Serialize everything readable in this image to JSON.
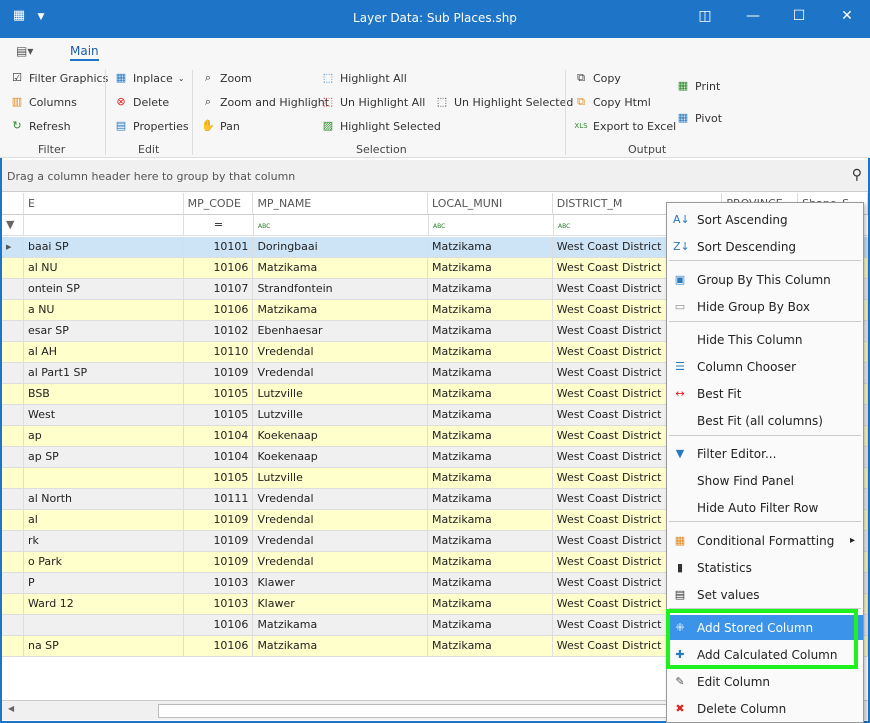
{
  "window": {
    "title": "Layer Data: Sub Places.shp",
    "restore": "◫",
    "maximize": "☐",
    "close": "✕"
  },
  "ribbon": {
    "tab": "Main",
    "filter": {
      "label": "Filter",
      "items": [
        "Filter Graphics",
        "Columns",
        "Refresh"
      ]
    },
    "edit": {
      "label": "Edit",
      "items": [
        "Inplace",
        "Delete",
        "Properties"
      ]
    },
    "selection": {
      "label": "Selection",
      "items": [
        "Zoom",
        "Zoom and Highlight",
        "Pan",
        "Highlight All",
        "Un Highlight All",
        "Highlight Selected",
        "Un Highlight Selected"
      ]
    },
    "output": {
      "label": "Output",
      "items": [
        "Copy",
        "Copy Html",
        "Export to Excel",
        "Print",
        "Pivot"
      ]
    }
  },
  "group_panel": "Drag a column header here to group by that column",
  "columns": [
    "E",
    "MP_CODE",
    "MP_NAME",
    "LOCAL_MUNI",
    "DISTRICT_M",
    "PROVINCE",
    "Shape_S"
  ],
  "filter_row": {
    "mp_code": "=",
    "text": "ABC"
  },
  "rows": [
    [
      "baai SP",
      "10101",
      "Doringbaai",
      "Matzikama",
      "West Coast District Mu"
    ],
    [
      "al NU",
      "10106",
      "Matzikama",
      "Matzikama",
      "West Coast District Mu"
    ],
    [
      "ontein SP",
      "10107",
      "Strandfontein",
      "Matzikama",
      "West Coast District Mu"
    ],
    [
      "a  NU",
      "10106",
      "Matzikama",
      "Matzikama",
      "West Coast District Mu"
    ],
    [
      "esar SP",
      "10102",
      "Ebenhaesar",
      "Matzikama",
      "West Coast District Mu"
    ],
    [
      "al AH",
      "10110",
      "Vredendal",
      "Matzikama",
      "West Coast District Mu"
    ],
    [
      "al Part1 SP",
      "10109",
      "Vredendal",
      "Matzikama",
      "West Coast District Mu"
    ],
    [
      "BSB",
      "10105",
      "Lutzville",
      "Matzikama",
      "West Coast District Mu"
    ],
    [
      "West",
      "10105",
      "Lutzville",
      "Matzikama",
      "West Coast District Mu"
    ],
    [
      "ap",
      "10104",
      "Koekenaap",
      "Matzikama",
      "West Coast District Mu"
    ],
    [
      "ap SP",
      "10104",
      "Koekenaap",
      "Matzikama",
      "West Coast District Mu"
    ],
    [
      "",
      "10105",
      "Lutzville",
      "Matzikama",
      "West Coast District Mu"
    ],
    [
      "al North",
      "10111",
      "Vredendal",
      "Matzikama",
      "West Coast District Mu"
    ],
    [
      "al",
      "10109",
      "Vredendal",
      "Matzikama",
      "West Coast District Mu"
    ],
    [
      "rk",
      "10109",
      "Vredendal",
      "Matzikama",
      "West Coast District Mu"
    ],
    [
      "o Park",
      "10109",
      "Vredendal",
      "Matzikama",
      "West Coast District Mu"
    ],
    [
      "P",
      "10103",
      "Klawer",
      "Matzikama",
      "West Coast District Mu"
    ],
    [
      "Ward 12",
      "10103",
      "Klawer",
      "Matzikama",
      "West Coast District Mu"
    ],
    [
      "",
      "10106",
      "Matzikama",
      "Matzikama",
      "West Coast District Mu"
    ],
    [
      "na SP",
      "10106",
      "Matzikama",
      "Matzikama",
      "West Coast District Mu"
    ]
  ],
  "context_menu": [
    {
      "label": "Sort Ascending",
      "icon": "sort-ascending-icon",
      "glyph": "A↓"
    },
    {
      "label": "Sort Descending",
      "icon": "sort-descending-icon",
      "glyph": "Z↓"
    },
    {
      "label": "Group By This Column",
      "icon": "group-by-icon",
      "glyph": "▣"
    },
    {
      "label": "Hide Group By Box",
      "icon": "hide-group-box-icon",
      "glyph": "▭"
    },
    {
      "label": "Hide This Column",
      "icon": "",
      "glyph": ""
    },
    {
      "label": "Column Chooser",
      "icon": "column-chooser-icon",
      "glyph": "☰"
    },
    {
      "label": "Best Fit",
      "icon": "best-fit-icon",
      "glyph": "↔"
    },
    {
      "label": "Best Fit (all columns)",
      "icon": "",
      "glyph": ""
    },
    {
      "label": "Filter Editor...",
      "icon": "filter-icon",
      "glyph": "▼"
    },
    {
      "label": "Show Find Panel",
      "icon": "",
      "glyph": ""
    },
    {
      "label": "Hide Auto Filter Row",
      "icon": "",
      "glyph": ""
    },
    {
      "label": "Conditional Formatting",
      "icon": "conditional-formatting-icon",
      "glyph": "▦",
      "submenu": "▸"
    },
    {
      "label": "Statistics",
      "icon": "statistics-icon",
      "glyph": "▮"
    },
    {
      "label": "Set values",
      "icon": "set-values-icon",
      "glyph": "▤"
    },
    {
      "label": "Add Stored Column",
      "icon": "add-stored-column-icon",
      "glyph": "⁜"
    },
    {
      "label": "Add Calculated Column",
      "icon": "add-calculated-column-icon",
      "glyph": "✚"
    },
    {
      "label": "Edit Column",
      "icon": "edit-column-icon",
      "glyph": "✎"
    },
    {
      "label": "Delete Column",
      "icon": "delete-column-icon",
      "glyph": "✖"
    }
  ],
  "colors": {
    "title_bar": "#1e74c6",
    "selected_row": "#cde4f7",
    "alt_row": "#ffffcc",
    "even_row": "#f0f0f0",
    "menu_highlight": "#3b93ea",
    "annotation_box": "#1ef21e"
  }
}
